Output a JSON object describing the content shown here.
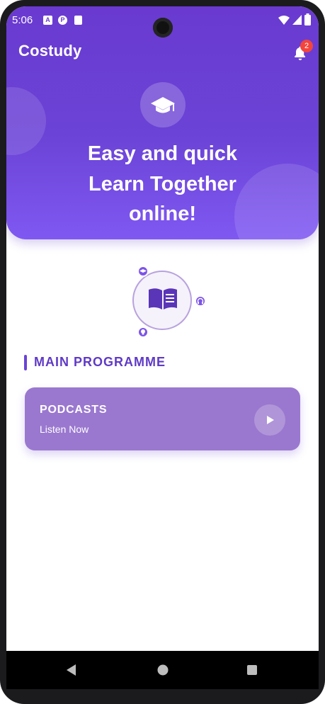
{
  "status_bar": {
    "time": "5:06",
    "notification_icons": [
      "A",
      "P",
      "card-icon"
    ]
  },
  "app": {
    "title": "Costudy",
    "notification_count": "2"
  },
  "hero": {
    "lines": [
      "Easy and quick",
      "Learn Together",
      "online!"
    ],
    "icon": "graduation-cap-icon"
  },
  "illustration": {
    "center_icon": "open-book-icon",
    "orbit_icons": [
      "graduation-cap-icon",
      "headphones-icon",
      "lightbulb-icon"
    ]
  },
  "section": {
    "title": "MAIN PROGRAMME"
  },
  "card": {
    "title": "PODCASTS",
    "subtitle": "Listen Now",
    "action_icon": "play-icon"
  },
  "colors": {
    "primary": "#6b43d6",
    "primary_light": "#7f58f2",
    "card": "#9a78cf",
    "badge": "#f2453d"
  }
}
